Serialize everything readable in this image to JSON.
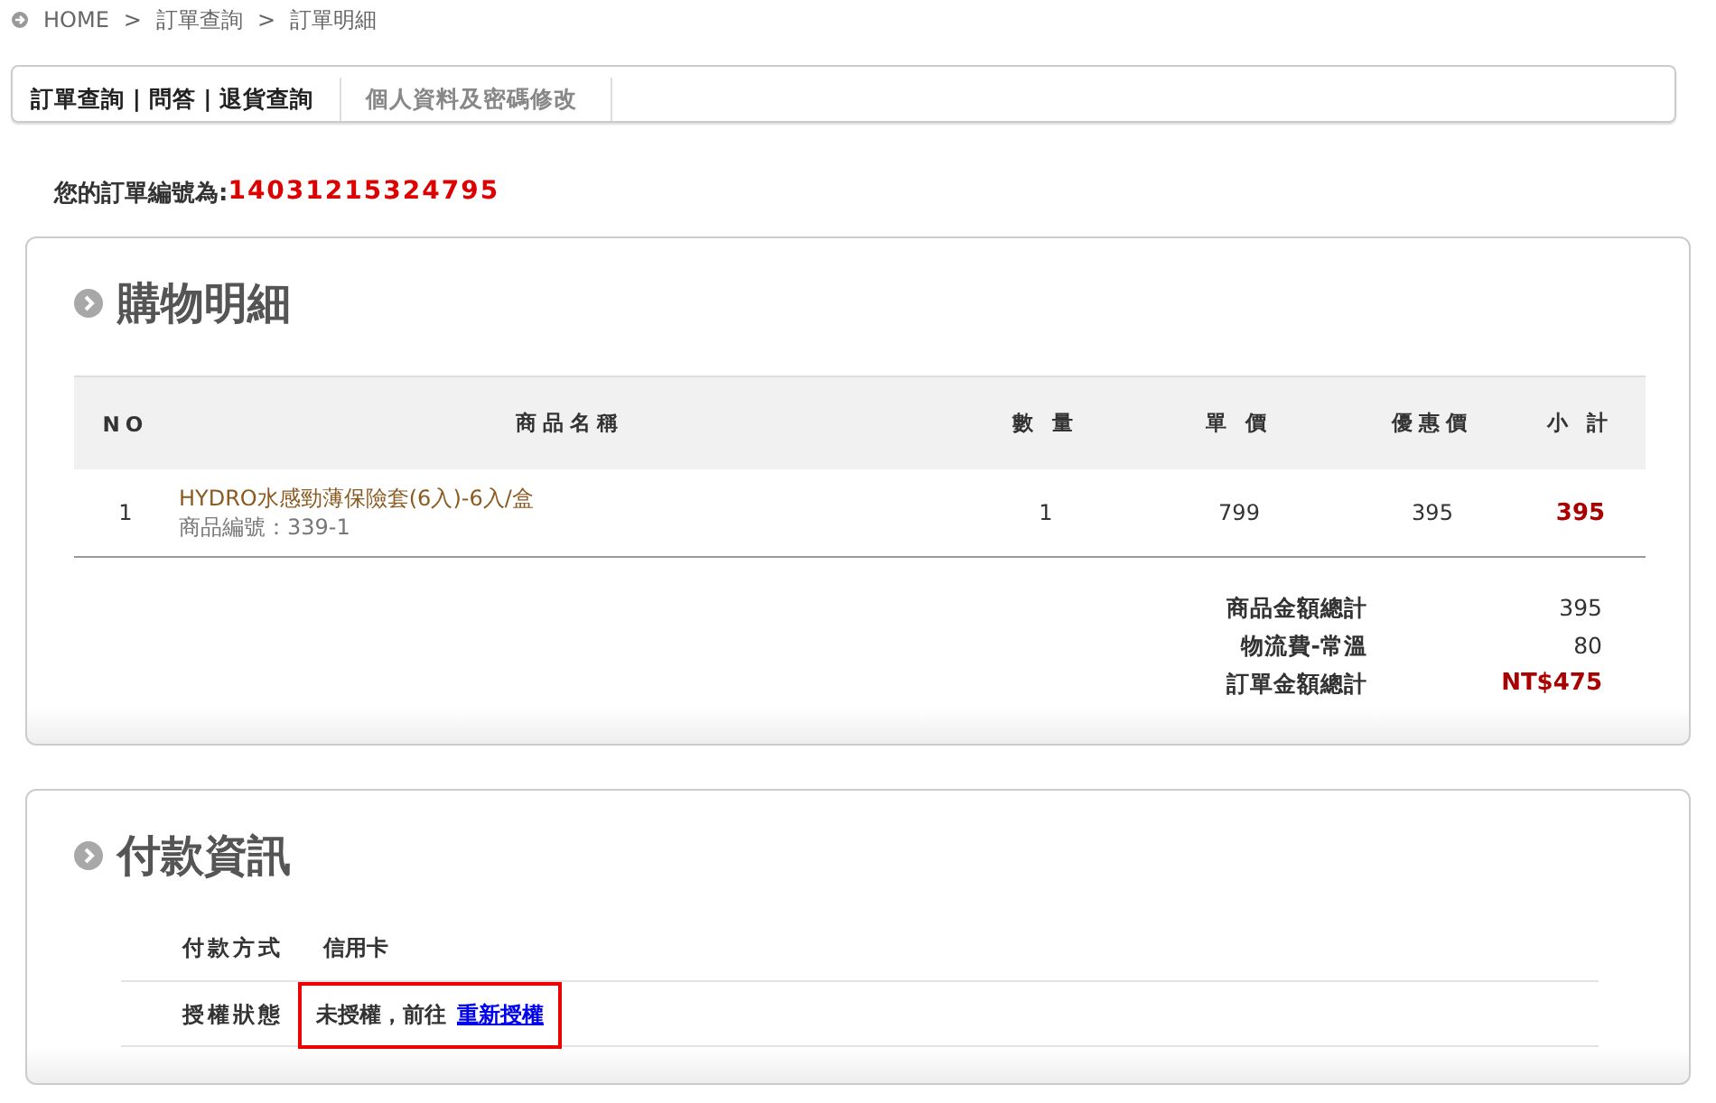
{
  "breadcrumb": [
    "HOME",
    "訂單查詢",
    "訂單明細"
  ],
  "breadcrumb_separator": ">",
  "tabs": [
    {
      "label": "訂單查詢 | 問答 | 退貨查詢",
      "selected": true
    },
    {
      "label": "個人資料及密碼修改",
      "selected": false
    }
  ],
  "order_number": {
    "label": "您的訂單編號為:",
    "value": "14031215324795"
  },
  "shopping": {
    "title": "購物明細",
    "table": {
      "columns": [
        "NO",
        "商品名稱",
        "數 量",
        "單 價",
        "優惠價",
        "小 計"
      ],
      "rows": [
        {
          "no": "1",
          "name": "HYDRO水感勁薄保險套(6入)-6入/盒",
          "code": "商品編號：339-1",
          "qty": "1",
          "price": "799",
          "discount": "395",
          "subtotal": "395"
        }
      ]
    },
    "totals": [
      {
        "label": "商品金額總計",
        "value": "395",
        "kind": "plain"
      },
      {
        "label": "物流費-常溫",
        "value": "80",
        "kind": "plain"
      },
      {
        "label": "訂單金額總計",
        "value": "NT$475",
        "kind": "grand"
      }
    ]
  },
  "payment": {
    "title": "付款資訊",
    "rows": [
      {
        "label": "付款方式",
        "value": "信用卡",
        "highlighted": false
      },
      {
        "label": "授權狀態",
        "value": "未授權，前往",
        "link": "重新授權",
        "highlighted": true
      }
    ]
  }
}
